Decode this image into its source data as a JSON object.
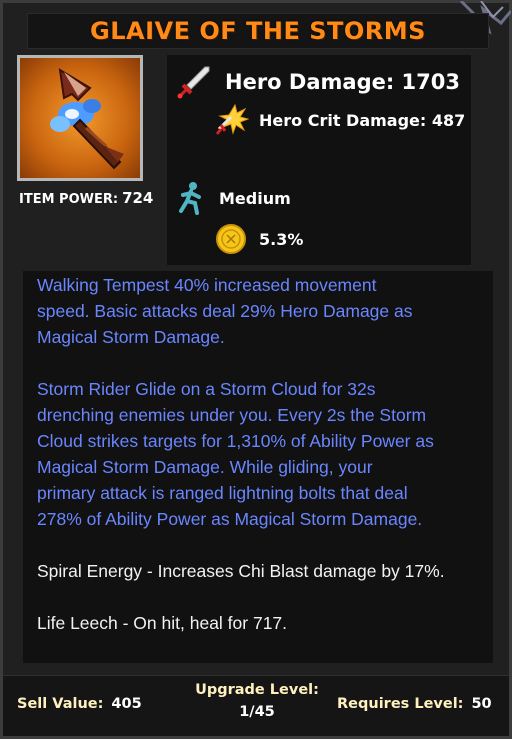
{
  "item": {
    "title": "GLAIVE OF THE STORMS",
    "power_label": "ITEM POWER:",
    "power_value": "724"
  },
  "stats": {
    "hero_damage": "Hero Damage: 1703",
    "hero_crit": "Hero Crit Damage: 487",
    "speed": "Medium",
    "crit_chance": "5.3%"
  },
  "description": {
    "blue_lines_1": [
      "Walking Tempest  40% increased movement",
      "speed. Basic attacks deal 29%  Hero Damage as",
      "Magical Storm Damage."
    ],
    "blue_lines_2": [
      "Storm Rider  Glide on a Storm Cloud for 32s",
      "drenching enemies under you. Every 2s the Storm",
      "Cloud strikes targets for 1,310% of Ability Power as",
      "Magical Storm Damage. While gliding, your",
      "primary attack is ranged lightning bolts that deal",
      "278% of Ability Power as Magical Storm Damage."
    ],
    "white_line_1": "Spiral Energy - Increases Chi Blast damage by 17%.",
    "white_line_2": "Life Leech - On hit, heal for 717."
  },
  "footer": {
    "sell_label": "Sell Value:",
    "sell_value": "405",
    "upgrade_label": "Upgrade Level:",
    "upgrade_value": "1/45",
    "requires_label": "Requires Level:",
    "requires_value": "50"
  },
  "icons": {
    "sword": "sword-icon",
    "crit": "crit-burst-icon",
    "speed": "running-figure-icon",
    "coin": "gold-coin-icon",
    "item": "glaive-weapon-icon"
  },
  "colors": {
    "title": "#ff8a18",
    "ability_text": "#6a86ff",
    "footer_label": "#fff1bf"
  }
}
